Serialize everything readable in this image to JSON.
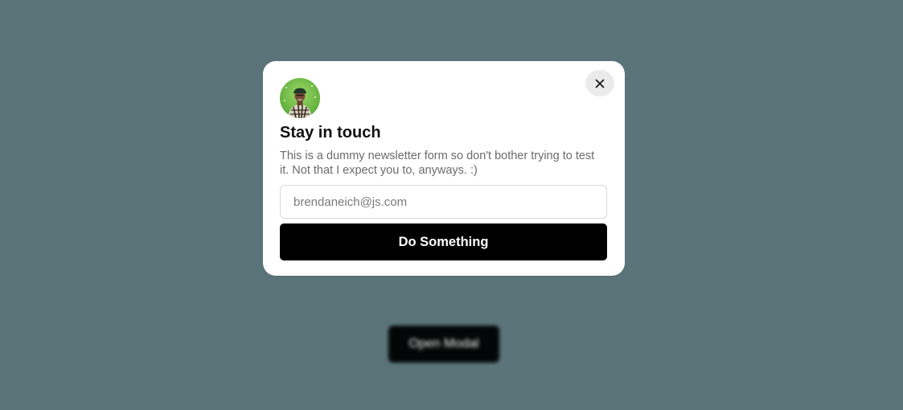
{
  "page": {
    "background_color": "#5b7479"
  },
  "trigger": {
    "open_modal_label": "Open Modal"
  },
  "modal": {
    "avatar_icon": "profile-photo",
    "title": "Stay in touch",
    "description": "This is a dummy newsletter form so don't bother trying to test it. Not that I expect you to, anyways. :)",
    "email_placeholder": "brendaneich@js.com",
    "email_value": "",
    "submit_label": "Do Something",
    "close_icon": "close-icon"
  },
  "colors": {
    "accent": "#000000",
    "modal_bg": "#ffffff",
    "close_bg": "#ebebeb"
  }
}
